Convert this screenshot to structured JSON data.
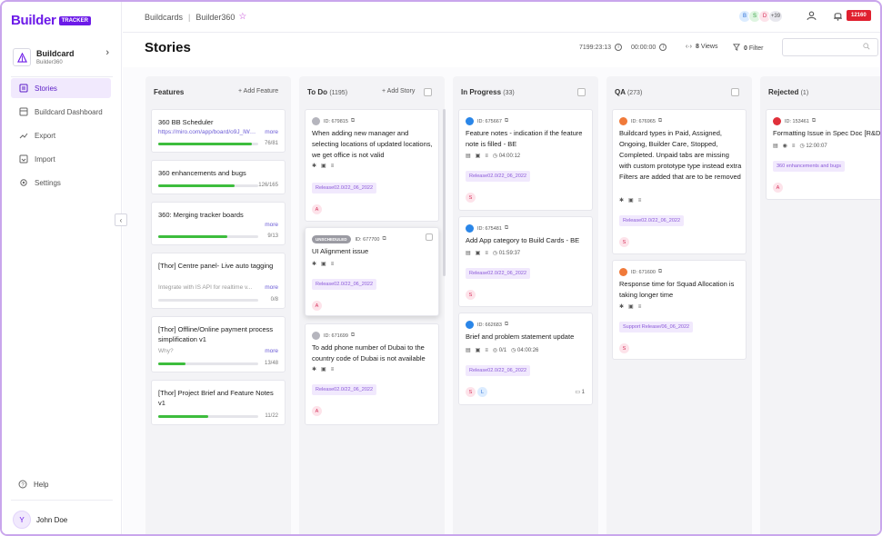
{
  "brand": {
    "logo": "Builder",
    "badge": "TRACKER"
  },
  "project": {
    "name": "Buildcard",
    "sub": "Builder360"
  },
  "nav": [
    {
      "label": "Stories",
      "icon": "stories-icon"
    },
    {
      "label": "Buildcard Dashboard",
      "icon": "dashboard-icon"
    },
    {
      "label": "Export",
      "icon": "export-icon"
    },
    {
      "label": "Import",
      "icon": "import-icon"
    },
    {
      "label": "Settings",
      "icon": "gear-icon"
    }
  ],
  "help": "Help",
  "user": {
    "initial": "Y",
    "name": "John Doe"
  },
  "breadcrumb": {
    "root": "Buildcards",
    "current": "Builder360"
  },
  "team": [
    {
      "initial": "B",
      "bg": "#dcecff",
      "fg": "#2a6fd6"
    },
    {
      "initial": "S",
      "bg": "#dff5e1",
      "fg": "#2d9b3a"
    },
    {
      "initial": "D",
      "bg": "#fde3ea",
      "fg": "#d6335c"
    }
  ],
  "team_more": "+39",
  "notif_badge": "12160",
  "page_title": "Stories",
  "timer1": "7199:23:13",
  "timer2": "00:00:00",
  "views": {
    "count": "8",
    "label": "Views"
  },
  "filter": {
    "count": "0",
    "label": "Filter"
  },
  "search": {
    "placeholder": ""
  },
  "features": {
    "title": "Features",
    "add": "+ Add Feature",
    "cards": [
      {
        "title": "360 BB Scheduler",
        "link": "https://miro.com/app/board/o9J_lWmQ",
        "more": "more",
        "count": "76/81",
        "progress": 0.94
      },
      {
        "title": "360 enhancements and bugs",
        "count": "126/165",
        "progress": 0.76
      },
      {
        "title": "360: Merging tracker boards",
        "more": "more",
        "count": "9/13",
        "progress": 0.69
      },
      {
        "title": "[Thor] Centre panel- Live auto tagging",
        "link": "Integrate with IS API for realtime v...",
        "more": "more",
        "count": "0/8",
        "progress": 0
      },
      {
        "title": "[Thor] Offline/Online payment process simplification v1",
        "link": "Why?",
        "more": "more",
        "count": "13/48",
        "progress": 0.27
      },
      {
        "title": "[Thor] Project Brief and Feature Notes v1",
        "count": "11/22",
        "progress": 0.5
      }
    ]
  },
  "columns": [
    {
      "title": "To Do",
      "count": "(1195)",
      "add": "+ Add Story",
      "cards": [
        {
          "id": "ID: 679815",
          "dot": "#b5b5bd",
          "title": "When adding new manager and selecting locations of updated locations, we get office is not valid",
          "tag": "Release02.0/22_06_2022",
          "avatars": [
            "A"
          ]
        },
        {
          "unscheduled": "UNSCHEDULED",
          "id": "ID: 677700",
          "dot": "",
          "title": "UI Alignment issue",
          "tag": "Release02.0/22_06_2022",
          "avatars": [
            "A"
          ]
        },
        {
          "id": "ID: 671699",
          "dot": "#b5b5bd",
          "title": "To add phone number of Dubai to the country code of Dubai is not available",
          "tag": "Release02.0/22_06_2022",
          "avatars": [
            "A"
          ]
        }
      ]
    },
    {
      "title": "In Progress",
      "count": "(33)",
      "cards": [
        {
          "id": "ID: 675667",
          "dot": "#2a86e8",
          "title": "Feature notes - indication if the feature note is filled - BE",
          "time": "04:00:12",
          "tag": "Release02.0/22_06_2022",
          "avatars": [
            "S"
          ]
        },
        {
          "id": "ID: 675481",
          "dot": "#2a86e8",
          "title": "Add App category to Build Cards - BE",
          "time": "01:59:37",
          "tag": "Release02.0/22_06_2022",
          "avatars": [
            "S"
          ]
        },
        {
          "id": "ID: 662683",
          "dot": "#2a86e8",
          "title": "Brief and problem statement update",
          "tasks": "0/1",
          "time": "04:00:26",
          "tag": "Release02.0/22_06_2022",
          "avatars": [
            "S",
            "L"
          ],
          "comments": "1"
        }
      ]
    },
    {
      "title": "QA",
      "count": "(273)",
      "cards": [
        {
          "id": "ID: 676965",
          "dot": "#f07a3a",
          "title": "Buildcard types in Paid, Assigned, Ongoing, Builder Care, Stopped, Completed. Unpaid tabs are missing with custom prototype type instead extra Filters are added that are to be removed",
          "tag": "Release02.0/22_06_2022",
          "avatars": [
            "S"
          ]
        },
        {
          "id": "ID: 671600",
          "dot": "#f07a3a",
          "title": "Response time for Squad Allocation is taking longer time",
          "tag": "Support Release/06_06_2022",
          "avatars": [
            "S"
          ]
        }
      ]
    },
    {
      "title": "Rejected",
      "count": "(1)",
      "cards": [
        {
          "id": "ID: 153461",
          "dot": "#e0303a",
          "title": "Formatting Issue in Spec Doc [R&D]",
          "time": "12:00:07",
          "tag": "360 enhancements and bugs",
          "avatars": [
            "A"
          ]
        }
      ]
    }
  ]
}
